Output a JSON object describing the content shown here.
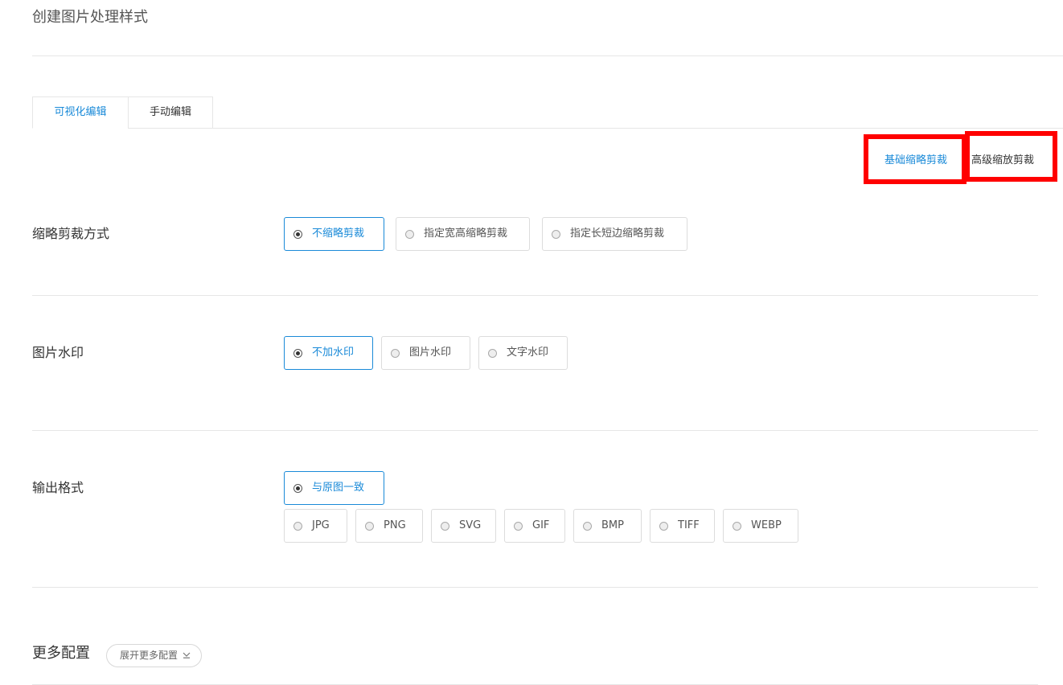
{
  "page_title": "创建图片处理样式",
  "tabs": [
    {
      "label": "可视化编辑",
      "active": true
    },
    {
      "label": "手动编辑",
      "active": false
    }
  ],
  "mode_toggle": {
    "basic": "基础缩略剪裁",
    "advanced": "高级缩放剪裁"
  },
  "crop": {
    "label": "缩略剪裁方式",
    "options": [
      "不缩略剪裁",
      "指定宽高缩略剪裁",
      "指定长短边缩略剪裁"
    ],
    "selected": "不缩略剪裁"
  },
  "watermark": {
    "label": "图片水印",
    "options": [
      "不加水印",
      "图片水印",
      "文字水印"
    ],
    "selected": "不加水印"
  },
  "output": {
    "label": "输出格式",
    "options": [
      "与原图一致",
      "JPG",
      "PNG",
      "SVG",
      "GIF",
      "BMP",
      "TIFF",
      "WEBP"
    ],
    "selected": "与原图一致"
  },
  "more": {
    "label": "更多配置",
    "button": "展开更多配置"
  },
  "colors": {
    "accent": "#1a8ad8",
    "highlight": "#ff0000"
  },
  "icons": {
    "expand": "chevron-down-icon",
    "radio": "radio-icon"
  }
}
